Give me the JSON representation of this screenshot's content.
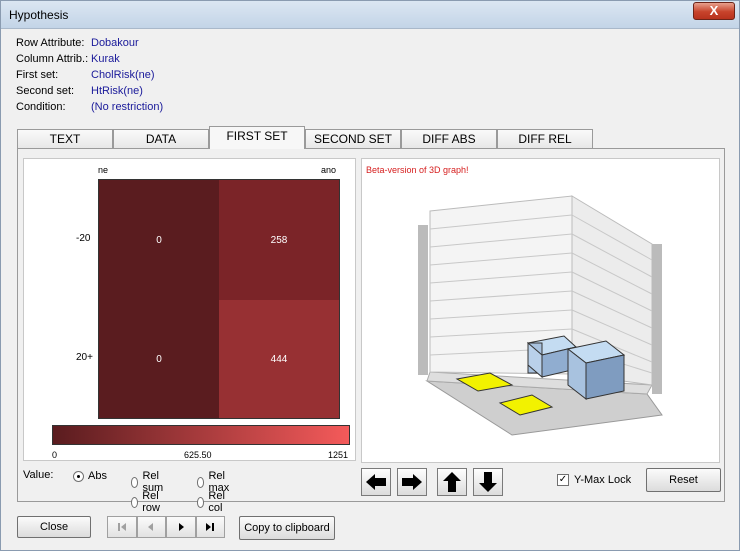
{
  "window": {
    "title": "Hypothesis",
    "close_glyph": "X"
  },
  "info": [
    {
      "label": "Row Attribute:",
      "value": "Dobakour"
    },
    {
      "label": "Column Attrib.:",
      "value": "Kurak"
    },
    {
      "label": "First set:",
      "value": "CholRisk(ne)"
    },
    {
      "label": "Second set:",
      "value": "HtRisk(ne)"
    },
    {
      "label": "Condition:",
      "value": "(No restriction)"
    }
  ],
  "tabs": [
    "TEXT",
    "DATA",
    "FIRST SET",
    "SECOND SET",
    "DIFF ABS",
    "DIFF REL"
  ],
  "active_tab": "FIRST SET",
  "heatmap": {
    "col_headers": [
      "ne",
      "ano"
    ],
    "row_headers": [
      "-20",
      "20+"
    ],
    "cells": [
      [
        "0",
        "258"
      ],
      [
        "0",
        "444"
      ]
    ],
    "cell_colors": [
      [
        "#5a1c1f",
        "#7b2428"
      ],
      [
        "#5a1c1f",
        "#973033"
      ]
    ],
    "scale_min": "0",
    "scale_mid": "625.50",
    "scale_max": "1251",
    "scale_colors": [
      "#5a1c1f",
      "#f45a5a"
    ]
  },
  "graph": {
    "beta_label": "Beta-version of 3D graph!",
    "beta_color": "#d62020"
  },
  "value_options": {
    "label": "Value:",
    "options": [
      "Abs",
      "Rel sum",
      "Rel max",
      "Rel row",
      "Rel col"
    ],
    "selected": "Abs"
  },
  "arrows": [
    "left-arrow-icon",
    "right-arrow-icon",
    "up-arrow-icon",
    "down-arrow-icon"
  ],
  "ymax_lock": {
    "label": "Y-Max Lock",
    "checked": true,
    "mark": "✓"
  },
  "buttons": {
    "reset": "Reset",
    "close": "Close",
    "copy": "Copy to clipboard"
  }
}
